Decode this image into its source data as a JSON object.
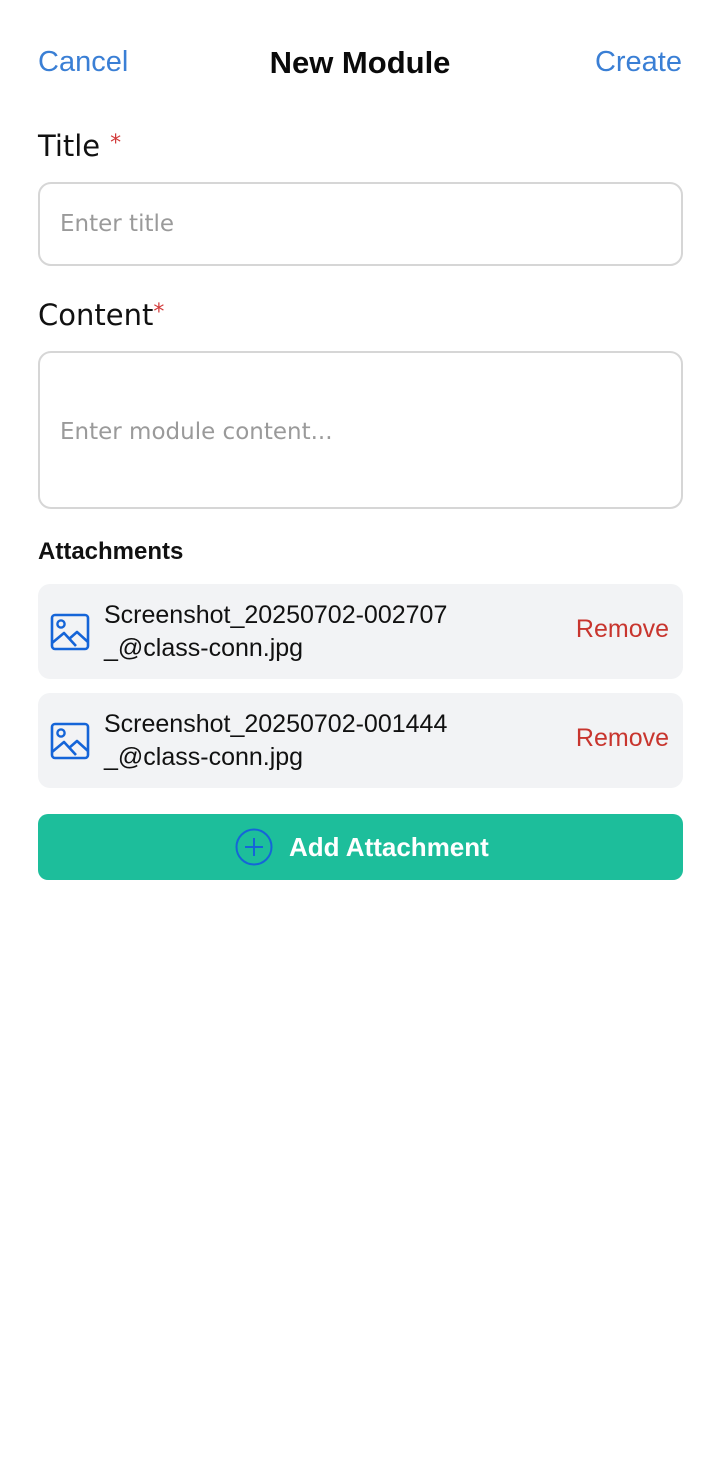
{
  "header": {
    "cancel_label": "Cancel",
    "title": "New Module",
    "create_label": "Create"
  },
  "form": {
    "title": {
      "label": "Title",
      "required_marker": "*",
      "placeholder": "Enter title",
      "value": ""
    },
    "content": {
      "label": "Content",
      "required_marker": "*",
      "placeholder": "Enter module content...",
      "value": ""
    }
  },
  "attachments": {
    "heading": "Attachments",
    "items": [
      {
        "icon": "image-file-icon",
        "name_line1": "Screenshot_20250702-002707",
        "name_line2": "_@class-conn.jpg",
        "remove_label": "Remove"
      },
      {
        "icon": "image-file-icon",
        "name_line1": "Screenshot_20250702-001444",
        "name_line2": "_@class-conn.jpg",
        "remove_label": "Remove"
      }
    ],
    "add_button": {
      "icon": "plus-circle-icon",
      "label": "Add Attachment"
    }
  },
  "colors": {
    "link_blue": "#3a7fd5",
    "required_red": "#d23a3a",
    "remove_red": "#c8352e",
    "accent_green": "#1dbe9b",
    "attachment_bg": "#f2f3f5",
    "icon_blue": "#1565d8"
  }
}
